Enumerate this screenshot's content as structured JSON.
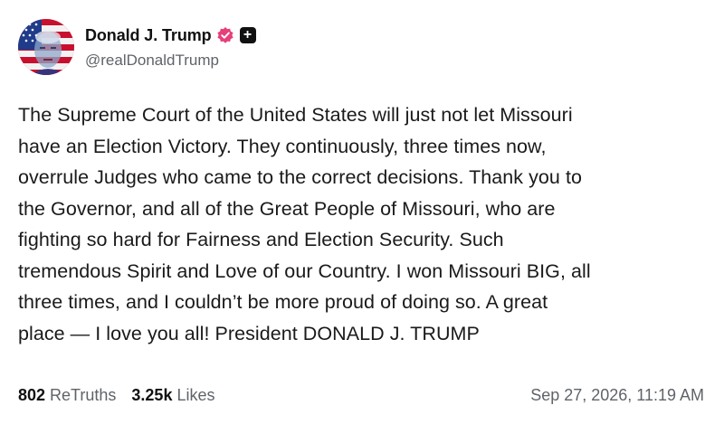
{
  "author": {
    "display_name": "Donald J. Trump",
    "handle": "@realDonaldTrump",
    "verified_icon": "verified-badge-icon",
    "plus_icon": "plus-badge-icon",
    "badge_color": "#e5407a"
  },
  "post": {
    "lines": [
      "The Supreme Court of the United States will just not let Missouri",
      "have an Election Victory. They continuously, three times now,",
      "overrule Judges who came to the correct decisions. Thank you to",
      "the Governor, and all of the Great People of Missouri, who are",
      "fighting so hard for Fairness and Election Security. Such",
      "tremendous Spirit and Love of our Country. I won Missouri BIG, all",
      "three times, and I couldn’t be more proud of doing so. A great",
      "place — I love you all! President DONALD J. TRUMP"
    ]
  },
  "stats": {
    "retruths_count": "802",
    "retruths_label": "ReTruths",
    "likes_count": "3.25k",
    "likes_label": "Likes"
  },
  "timestamp": "Sep 27, 2026, 11:19 AM"
}
